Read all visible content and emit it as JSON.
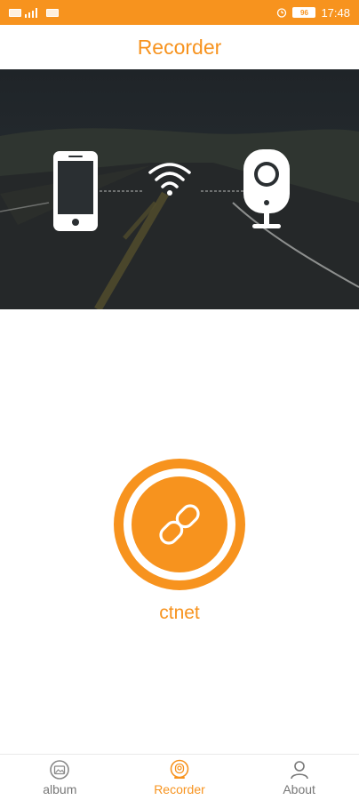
{
  "status_bar": {
    "time": "17:48",
    "battery": "96",
    "icons": [
      "sim-icon",
      "signal-icon",
      "wifi-icon",
      "alarm-icon",
      "battery-icon"
    ]
  },
  "header": {
    "title": "Recorder"
  },
  "banner": {
    "icons": [
      "phone-icon",
      "wifi-signal-icon",
      "camera-icon"
    ]
  },
  "connect": {
    "device_name": "ctnet",
    "icon": "link-icon"
  },
  "tabs": [
    {
      "label": "album",
      "icon": "album-icon",
      "active": false
    },
    {
      "label": "Recorder",
      "icon": "recorder-icon",
      "active": true
    },
    {
      "label": "About",
      "icon": "person-icon",
      "active": false
    }
  ],
  "colors": {
    "accent": "#F7931E",
    "inactive": "#777777",
    "banner_bg": "#23272A"
  }
}
